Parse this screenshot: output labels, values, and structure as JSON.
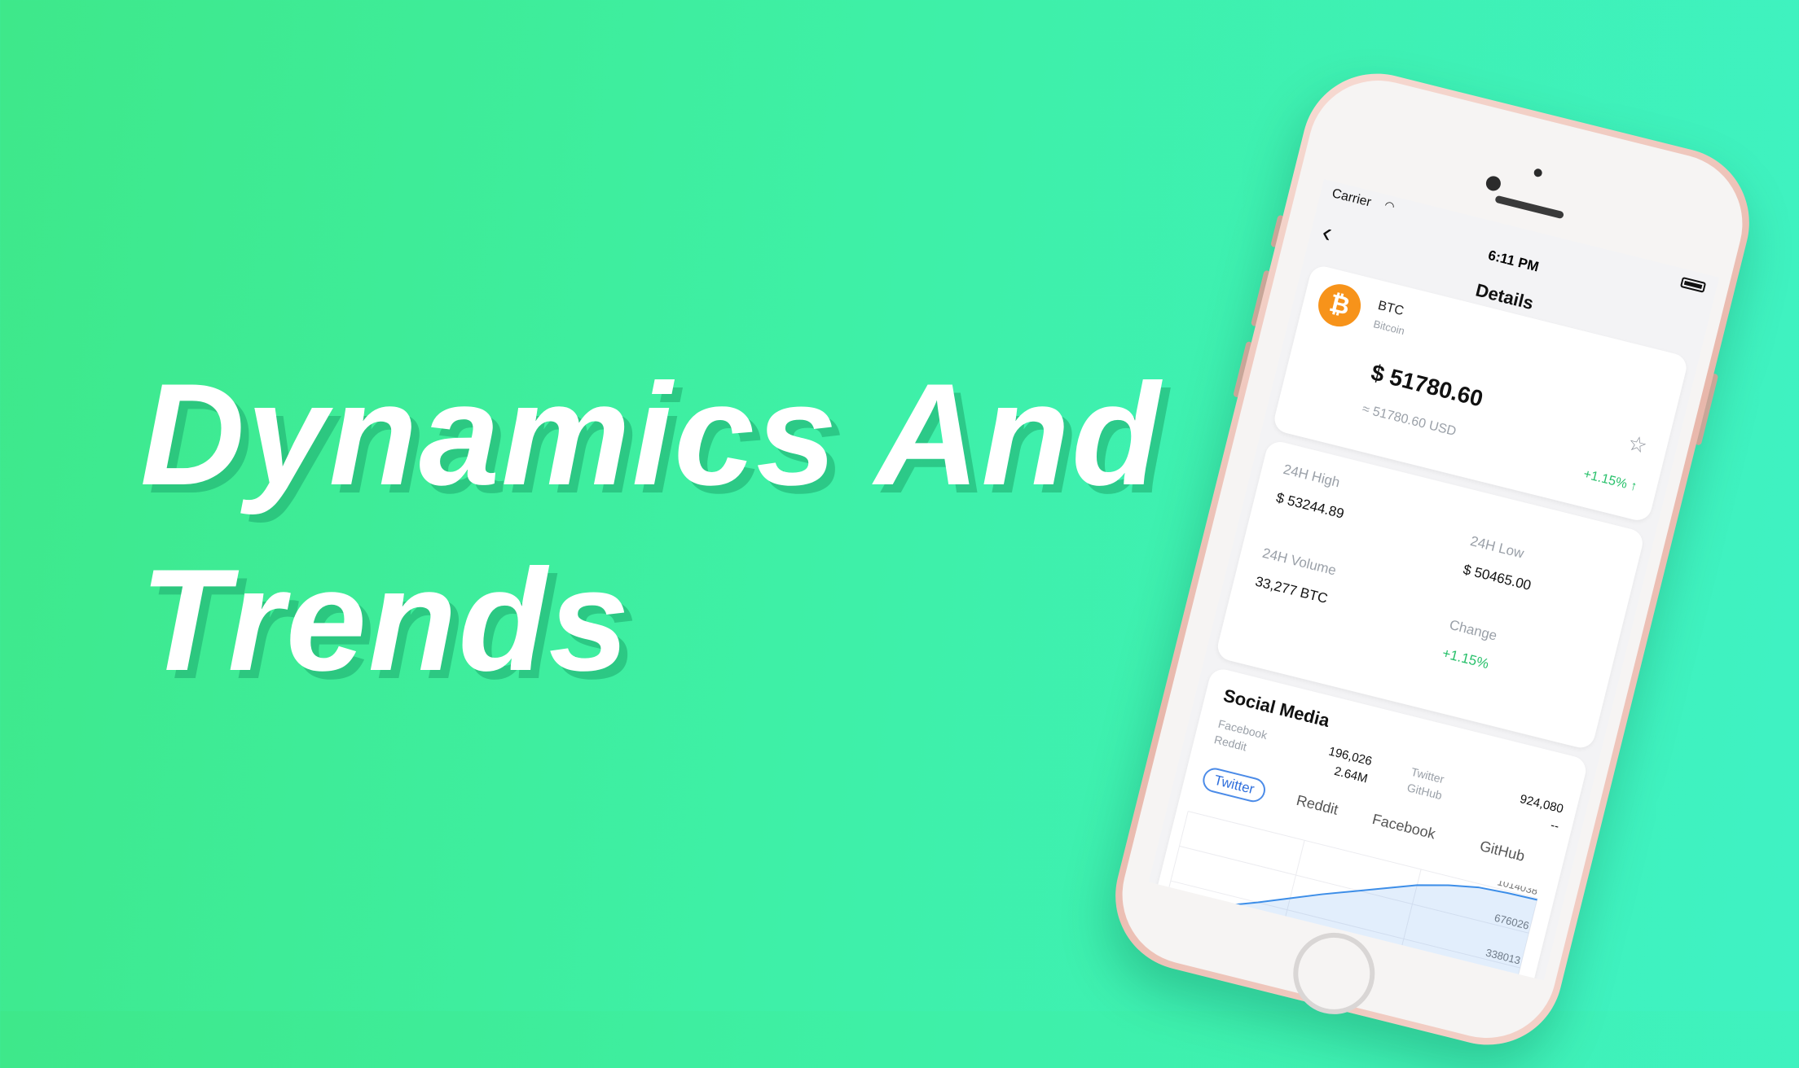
{
  "headline": {
    "line1": "Dynamics And",
    "line2": "Trends"
  },
  "status": {
    "carrier": "Carrier",
    "time": "6:11 PM"
  },
  "nav": {
    "title": "Details"
  },
  "coin": {
    "symbol": "BTC",
    "name": "Bitcoin",
    "price": "$ 51780.60",
    "usd": "≈ 51780.60 USD",
    "change": "+1.15% ↑",
    "icon": "bitcoin-icon"
  },
  "stats": {
    "high_label": "24H High",
    "high_value": "$ 53244.89",
    "low_label": "24H Low",
    "low_value": "$ 50465.00",
    "volume_label": "24H Volume",
    "volume_value": "33,277 BTC",
    "change_label": "Change",
    "change_value": "+1.15%"
  },
  "social": {
    "title": "Social Media",
    "facebook_label": "Facebook",
    "reddit_label": "Reddit",
    "facebook_value": "196,026",
    "reddit_value": "2.64M",
    "twitter_label": "Twitter",
    "github_label": "GitHub",
    "twitter_value": "924,080",
    "github_value": "--",
    "tabs": [
      "Twitter",
      "Reddit",
      "Facebook",
      "GitHub"
    ],
    "active_tab": "Twitter"
  },
  "colors": {
    "accent_green": "#27c06a",
    "tab_blue": "#2f6fdc",
    "bitcoin": "#f7931a",
    "line": "#3d8ee8"
  },
  "chart_data": {
    "type": "area",
    "y_ticks": [
      1014038,
      676026,
      338013
    ],
    "series": [
      {
        "values": [
          130000,
          160000,
          240000,
          340000,
          450000,
          560000,
          660000,
          760000,
          860000,
          930000,
          980000,
          995000,
          1000000
        ]
      }
    ],
    "ylim": [
      0,
      1014038
    ],
    "grid": true
  }
}
